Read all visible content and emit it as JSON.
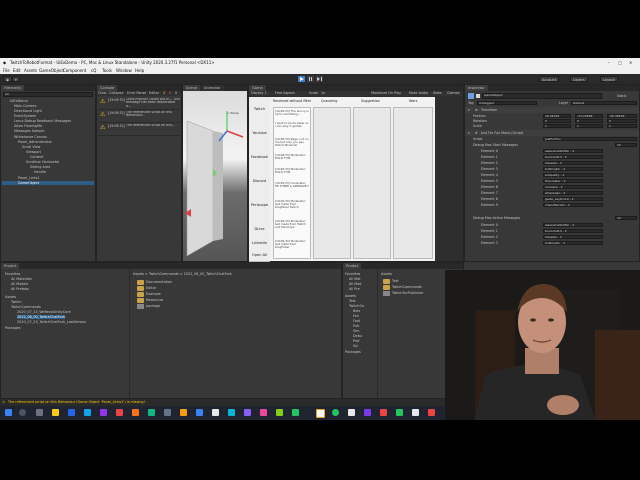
{
  "titlebar": {
    "title": "TwitchToRobotFormat - UiExDemo - PC, Mac & Linux Standalone - Unity 2020.3.27f1 Personal <DX11>",
    "controls": [
      "–",
      "□",
      "✕"
    ]
  },
  "menubar": {
    "items": [
      "File",
      "Edit",
      "Assets",
      "GameObject",
      "Component",
      "cQ",
      "Tools",
      "Window",
      "Help"
    ]
  },
  "toolbar": {
    "left_buttons": [
      "◉",
      "▾"
    ],
    "account": "Account",
    "layers": "Layers",
    "layout": "Layout"
  },
  "hierarchy": {
    "tab": "Hierarchy",
    "search_placeholder": "All",
    "items": [
      "UiExDemo",
      "Main Camera",
      "Directional Light",
      "EventSystem",
      "Lorux Debug Readback Messages",
      "Allow FlowingMe",
      "Messages Sample",
      "Whitehorse Canvas",
      "Panel_Administrator",
      "Scroll View",
      "Viewport",
      "Content",
      "Scrollbar Horizontal",
      "Sliding Area",
      "Handle",
      "Panel_Links1",
      "GameObject"
    ]
  },
  "console": {
    "tab": "Console",
    "toolbar": [
      "Clear",
      "Collapse",
      "Error Pause",
      "Editor"
    ],
    "counts": [
      "3",
      "0",
      "0"
    ],
    "rows": [
      {
        "time": "[19:09:30]",
        "text": "Once-mWhich called but th... This message has been deprecated a..."
      },
      {
        "time": "[19:09:32]",
        "text": "The referenced script on this Behaviour..."
      },
      {
        "time": "[19:09:32]",
        "text": "The referenced script on this..."
      }
    ]
  },
  "scene": {
    "tab": "Scene",
    "persp": "< Persp"
  },
  "animator": {
    "tab": "Animator"
  },
  "game": {
    "tab": "Game",
    "display": "Display 1",
    "aspect": "Free Aspect",
    "scale_label": "Scale",
    "scale_value": "1x",
    "options": [
      "Maximize On Play",
      "Mute Audio",
      "Stats",
      "Gizmos"
    ],
    "columns": [
      "Received without filter",
      "Queueing",
      "Suggestion",
      "Wars"
    ],
    "sidebar": [
      "Twitch",
      "Youtube",
      "Facebook",
      "Discord",
      "Periscope",
      "DLive",
      "LinkedIn",
      "Open All"
    ],
    "messages": [
      "[19:09:33] The bunny is up to something...",
      "I want to be its sister so I can play it games",
      "[19:09:33] Rage: not on me but only you pay Twitch Streamer",
      "[19:09:33] Moderator: HOLD THIS",
      "[19:09:33] Moderator: HOLD THIS",
      "[19:09:33] moderator: HE THREE A GRENADE!!",
      "[19:09:33] Moderator: Get made from Kingfisher Twitch",
      "[19:09:33] Moderator: Get made from Twitch and Periscope",
      "[19:09:33] Moderator: Get made from KingFisher"
    ]
  },
  "inspector": {
    "tab": "Inspector",
    "object_name": "GameObject",
    "static_label": "Static",
    "tag_label": "Tag",
    "tag_value": "Untagged",
    "layer_label": "Layer",
    "layer_value": "Default",
    "transform": {
      "title": "Transform",
      "rows": [
        {
          "label": "Position",
          "x": "49.26316",
          "y": "-23.24486",
          "z": "-56.36818"
        },
        {
          "label": "Rotation",
          "x": "0",
          "y": "0",
          "z": "0"
        },
        {
          "label": "Scale",
          "x": "1",
          "y": "1",
          "z": "1"
        }
      ]
    },
    "script": {
      "title": "Just For Fun Mono (Script)",
      "script_label": "Script",
      "script_value": "JustForFun",
      "start_header": "Debug Max Start Messages",
      "start_count": "10",
      "start_elements": [
        {
          "label": "Element 0",
          "value": "awesomeStuffer - 2"
        },
        {
          "label": "Element 1",
          "value": "bocoolot13 - 2"
        },
        {
          "label": "Element 2",
          "value": "streelsa - 2"
        },
        {
          "label": "Element 3",
          "value": "buttonjkin - 2"
        },
        {
          "label": "Element 4",
          "value": "ediquetty - 2"
        },
        {
          "label": "Element 5",
          "value": "thecreator - 2"
        },
        {
          "label": "Element 6",
          "value": "nocolpie - 2"
        },
        {
          "label": "Element 7",
          "value": "whereslen - 2"
        },
        {
          "label": "Element 8",
          "value": "galax_sayton10 - 2"
        },
        {
          "label": "Element 9",
          "value": "chaosfish101 - 2"
        }
      ],
      "active_header": "Debug Max Active Messages",
      "active_count": "10",
      "active_elements": [
        {
          "label": "Element 0",
          "value": "awesomeStuffer - 2"
        },
        {
          "label": "Element 1",
          "value": "bocoolot13 - 2"
        },
        {
          "label": "Element 2",
          "value": "streelsa - 2"
        },
        {
          "label": "Element 3",
          "value": "buttonjkin - 2"
        }
      ]
    }
  },
  "project": {
    "tab": "Project",
    "tree": [
      "Favorites",
      "All Materials",
      "All Models",
      "All Prefabs",
      "Assets",
      "Twitch",
      "TwitchCommands",
      "2020_07_13_WeRevolUnityCore",
      "2022_08_00_TwitchChatFork",
      "2020_07_23_TwitchChatFork_LastVersion",
      "Packages"
    ],
    "breadcrumb": "Assets > TwitchCommands > 2022_08_00_TwitchChatFork",
    "folders": [
      "Documentation",
      "Editor",
      "Example",
      "Resources",
      "package"
    ]
  },
  "project2": {
    "tab": "Project",
    "tree": [
      "Favorites",
      "All Mat",
      "All Mod",
      "All Pre",
      "Assets",
      "Test",
      "TwitchCo",
      "Bels",
      "Fen",
      "Font",
      "Pub",
      "Sim",
      "Debu",
      "Prof",
      "Sui",
      "Packages"
    ],
    "breadcrumb": "Assets",
    "files": [
      "Test",
      "TwitchCommands",
      "TwitchForPublisher"
    ]
  },
  "status": {
    "text": "The referenced script on this Behaviour (Game Object 'Panel_Links1') is missing!"
  },
  "taskbar": {
    "colors": [
      "#ffffff",
      "#e6e6e6",
      "#3b82f6",
      "#f59e0b",
      "#10b981",
      "#6366f1",
      "#ef4444",
      "#14b8a6",
      "#a855f7",
      "#f97316"
    ]
  }
}
